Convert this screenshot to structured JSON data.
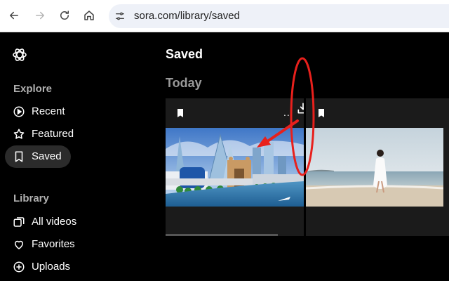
{
  "browser": {
    "url": "sora.com/library/saved",
    "icons": [
      "back-icon",
      "forward-icon",
      "reload-icon",
      "home-icon",
      "tune-icon"
    ]
  },
  "sidebar": {
    "sections": [
      {
        "label": "Explore"
      },
      {
        "label": "Library"
      }
    ],
    "explore_items": [
      {
        "label": "Recent",
        "icon": "play-circle-icon"
      },
      {
        "label": "Featured",
        "icon": "star-icon"
      },
      {
        "label": "Saved",
        "icon": "bookmark-icon",
        "active": true
      }
    ],
    "library_items": [
      {
        "label": "All videos",
        "icon": "videos-icon"
      },
      {
        "label": "Favorites",
        "icon": "heart-icon"
      },
      {
        "label": "Uploads",
        "icon": "plus-circle-icon"
      }
    ]
  },
  "main": {
    "title": "Saved",
    "group_label": "Today",
    "more_label": "...",
    "cards": [
      {
        "thumbnail": "futuristic-city-gateway"
      },
      {
        "thumbnail": "woman-walking-on-beach"
      }
    ]
  },
  "colors": {
    "background": "#000000",
    "card": "#1b1b1b",
    "active_item": "#2b2b2b",
    "annotation": "#e8201c"
  }
}
